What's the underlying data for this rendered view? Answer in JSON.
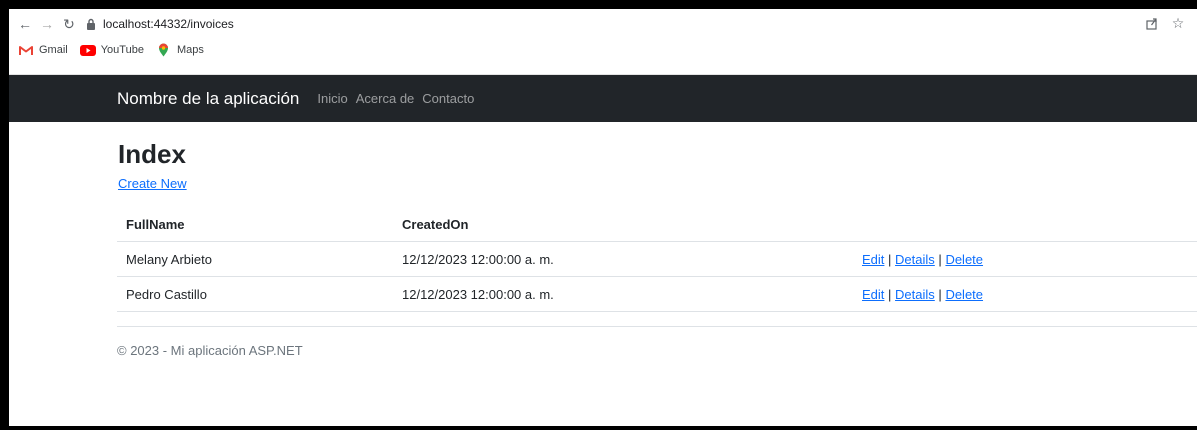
{
  "browser": {
    "url": "localhost:44332/invoices",
    "bookmarks": [
      {
        "label": "Gmail",
        "icon": "gmail-icon"
      },
      {
        "label": "YouTube",
        "icon": "youtube-icon"
      },
      {
        "label": "Maps",
        "icon": "maps-icon"
      }
    ]
  },
  "navbar": {
    "brand": "Nombre de la aplicación",
    "links": [
      "Inicio",
      "Acerca de",
      "Contacto"
    ],
    "background": "#212529"
  },
  "main": {
    "title": "Index",
    "create_link": "Create New",
    "table": {
      "headers": [
        "FullName",
        "CreatedOn"
      ],
      "rows": [
        {
          "full_name": "Melany Arbieto",
          "created_on": "12/12/2023 12:00:00 a. m."
        },
        {
          "full_name": "Pedro Castillo",
          "created_on": "12/12/2023 12:00:00 a. m."
        }
      ],
      "actions": {
        "edit": "Edit",
        "details": "Details",
        "delete": "Delete",
        "separator": "|"
      }
    }
  },
  "footer": {
    "text": "© 2023 - Mi aplicación ASP.NET"
  },
  "colors": {
    "link": "#0d6efd",
    "text": "#212529",
    "muted": "#6c757d"
  }
}
